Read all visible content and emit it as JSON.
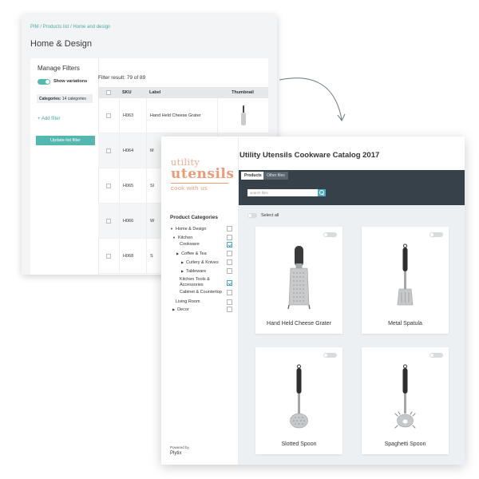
{
  "pim": {
    "breadcrumb": "PIM / Products list / Home and design",
    "title": "Home & Design",
    "manage_filters": "Manage Filters",
    "show_variations": "Show variations",
    "categories_label": "Categories:",
    "categories_value": "14 categories",
    "add_filter": "+ Add filter",
    "update_button": "Update list filter",
    "filter_result": "Filter result: 79 of 89",
    "columns": [
      "SKU",
      "Label",
      "Thumbnail"
    ],
    "rows": [
      {
        "sku": "H063",
        "label": "Hand Held Cheese Grater"
      },
      {
        "sku": "H064",
        "label": "M"
      },
      {
        "sku": "H065",
        "label": "Sl"
      },
      {
        "sku": "H066",
        "label": "W"
      },
      {
        "sku": "H068",
        "label": "S"
      }
    ]
  },
  "catalog": {
    "logo_line1": "utility",
    "logo_line2": "utensils",
    "logo_line3": "cook with us",
    "title": "Utility Utensils Cookware Catalog 2017",
    "tabs": [
      "Products",
      "Other files"
    ],
    "search_placeholder": "search files",
    "select_all": "Select all",
    "categories_heading": "Product Categories",
    "tree": [
      {
        "label": "Home & Design",
        "arrow": "▼",
        "checked": false
      },
      {
        "label": "Kitchen",
        "arrow": "▼",
        "checked": false
      },
      {
        "label": "Cookware",
        "arrow": "",
        "checked": true
      },
      {
        "label": "Coffee & Tea",
        "arrow": "▶",
        "checked": false
      },
      {
        "label": "Cutlery & Knives",
        "arrow": "▶",
        "checked": false
      },
      {
        "label": "Tableware",
        "arrow": "▶",
        "checked": false
      },
      {
        "label": "Kitchen Tools & Accessories",
        "arrow": "",
        "checked": true
      },
      {
        "label": "Cabinet & Countertop",
        "arrow": "",
        "checked": false
      },
      {
        "label": "Living Room",
        "arrow": "",
        "checked": false
      },
      {
        "label": "Decor",
        "arrow": "▶",
        "checked": false
      }
    ],
    "powered_by": "Powered by",
    "powered_brand": "Plytix",
    "products": [
      {
        "name": "Hand Held Cheese Grater",
        "icon": "grater-icon"
      },
      {
        "name": "Metal Spatula",
        "icon": "spatula-icon"
      },
      {
        "name": "Slotted Spoon",
        "icon": "slotted-spoon-icon"
      },
      {
        "name": "Spaghetti Spoon",
        "icon": "spaghetti-spoon-icon"
      }
    ]
  },
  "colors": {
    "teal": "#55b8b0",
    "coral": "#ec9a78",
    "dark_header": "#37414a",
    "check_blue": "#4aa9c4"
  }
}
